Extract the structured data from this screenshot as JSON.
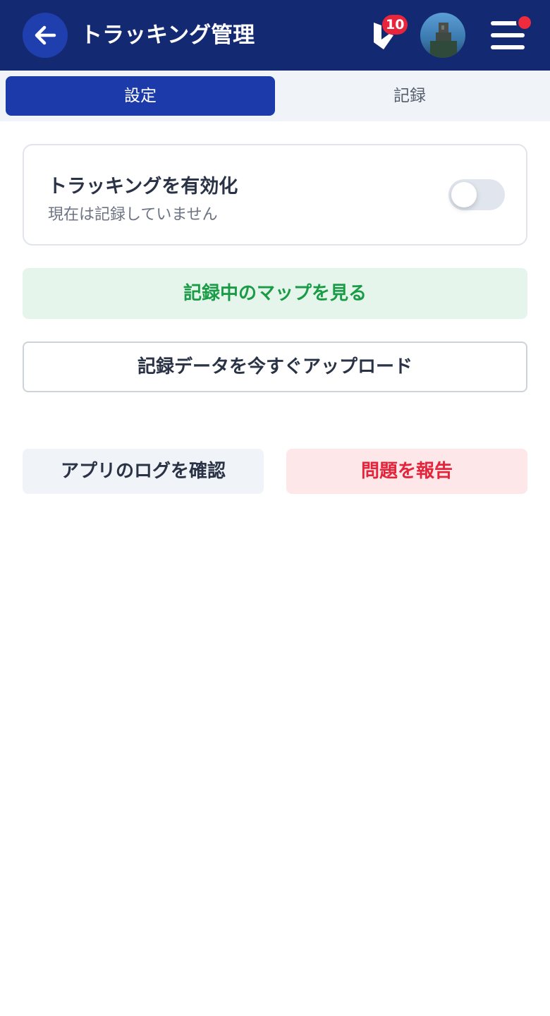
{
  "header": {
    "title": "トラッキング管理",
    "notification_count": "10",
    "icons": {
      "back": "arrow-left-icon",
      "logo": "app-logo-icon",
      "avatar": "user-avatar",
      "menu": "hamburger-menu-icon"
    },
    "colors": {
      "background": "#132a73",
      "badge": "#e8253a"
    }
  },
  "tabs": [
    {
      "label": "設定",
      "active": true
    },
    {
      "label": "記録",
      "active": false
    }
  ],
  "tracking_card": {
    "title": "トラッキングを有効化",
    "subtitle": "現在は記録していません",
    "toggle_on": false
  },
  "actions": {
    "view_map": "記録中のマップを見る",
    "upload_now": "記録データを今すぐアップロード",
    "view_logs": "アプリのログを確認",
    "report_problem": "問題を報告"
  },
  "colors": {
    "primary": "#1c3aa9",
    "success": "#1a9c47",
    "danger": "#e3243b"
  }
}
